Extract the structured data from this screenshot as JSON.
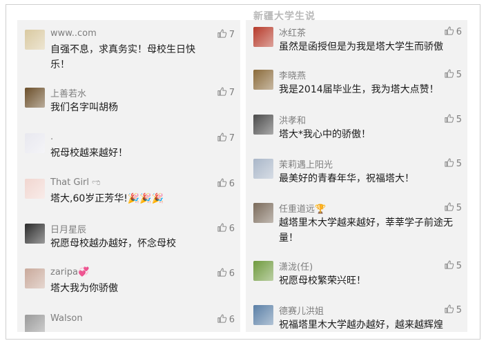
{
  "header": {
    "title": "新疆大学生说"
  },
  "left_comments": [
    {
      "name": "www..com",
      "text": "自强不息，求真务实！母校生日快乐！",
      "likes": "7",
      "avatar_color": "#d9c9a0",
      "avatar_icon": "dog-avatar"
    },
    {
      "name": "上善若水",
      "text": "我们名字叫胡杨",
      "likes": "7",
      "avatar_color": "#6b4f2a",
      "avatar_icon": "cat-avatar"
    },
    {
      "name": ".",
      "text": "祝母校越来越好！",
      "likes": "7",
      "avatar_color": "#e8e8ef",
      "avatar_icon": "robot-avatar"
    },
    {
      "name": " That Girl ಌ",
      "text": "塔大,60岁正芳华!🎉🎉🎉",
      "likes": "6",
      "avatar_color": "#f1d6d0",
      "avatar_icon": "rabbit-avatar"
    },
    {
      "name": "日月星辰",
      "text": "祝愿母校越办越好，怀念母校",
      "likes": "6",
      "avatar_color": "#2b2b2b",
      "avatar_icon": "emblem-avatar"
    },
    {
      "name": "zaripa💞",
      "text": "塔大我为你骄傲",
      "likes": "6",
      "avatar_color": "#c9a99b",
      "avatar_icon": "girl-avatar"
    },
    {
      "name": "Walson",
      "text": "",
      "likes": "6",
      "avatar_color": "#9a9a9a",
      "avatar_icon": "photo-avatar"
    }
  ],
  "right_comments": [
    {
      "name": "冰红茶",
      "text": "虽然是函授但是为我是塔大学生而骄傲",
      "likes": "6",
      "avatar_color": "#b63a2a",
      "avatar_icon": "person-avatar"
    },
    {
      "name": "李晓燕",
      "text": "我是2014届毕业生，我为塔大点赞！",
      "likes": "5",
      "avatar_color": "#8a6a3a",
      "avatar_icon": "flower-avatar"
    },
    {
      "name": "洪孝和",
      "text": "塔大*我心中的骄傲！",
      "likes": "5",
      "avatar_color": "#4a4a4a",
      "avatar_icon": "person-avatar"
    },
    {
      "name": "茉莉遇上阳光",
      "text": "最美好的青春年华，祝福塔大！",
      "likes": "5",
      "avatar_color": "#a9b6c8",
      "avatar_icon": "landscape-avatar"
    },
    {
      "name": "任重道远🏆",
      "text": "越塔里木大学越来越好，莘莘学子前途无量！",
      "likes": "5",
      "avatar_color": "#7a6a5a",
      "avatar_icon": "person-avatar"
    },
    {
      "name": "潇泷(任)",
      "text": "祝愿母校繁荣兴旺！",
      "likes": "5",
      "avatar_color": "#6f9a3e",
      "avatar_icon": "landscape-avatar"
    },
    {
      "name": "德赛儿洪姐",
      "text": "祝福塔里木大学越办越好，越来越辉煌",
      "likes": "5",
      "avatar_color": "#5a7fa6",
      "avatar_icon": "landscape-avatar"
    }
  ]
}
